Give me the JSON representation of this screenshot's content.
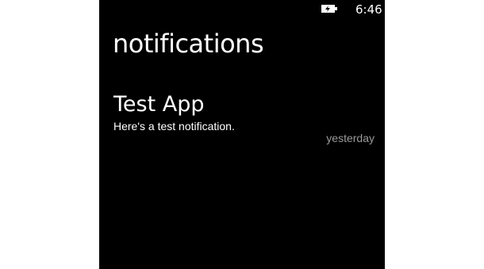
{
  "status_bar": {
    "battery_icon": "battery-charging-icon",
    "time": "6:46"
  },
  "page": {
    "title": "notifications"
  },
  "notifications": [
    {
      "app": "Test App",
      "message": "Here's a test notification.",
      "time": "yesterday"
    }
  ],
  "colors": {
    "background": "#000000",
    "text": "#ffffff",
    "timestamp": "#9a9a9a"
  }
}
